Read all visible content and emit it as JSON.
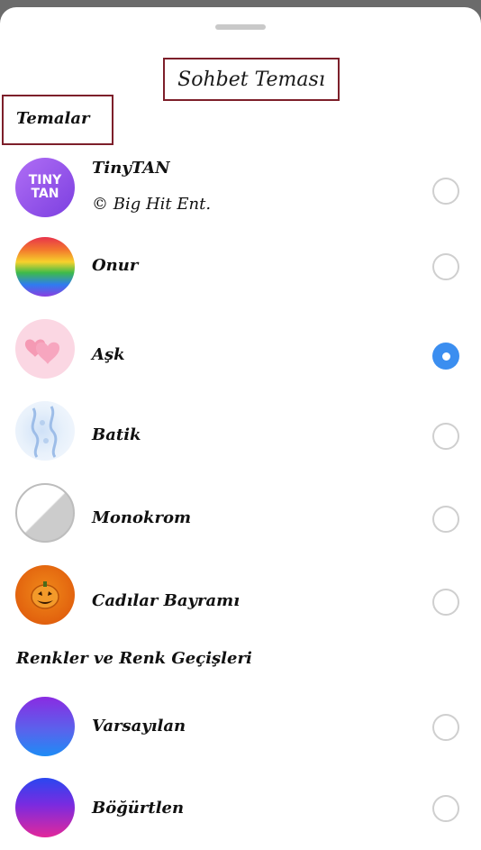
{
  "sheet": {
    "title": "Sohbet Teması"
  },
  "sections": {
    "themes": "Temalar",
    "colors": "Renkler ve Renk Geçişleri"
  },
  "themes": [
    {
      "name": "TinyTAN",
      "subtitle": "© Big Hit Ent.",
      "icon": "tinytan-logo",
      "icon_text": "TINY TAN",
      "selected": false
    },
    {
      "name": "Onur",
      "icon": "rainbow-gradient",
      "selected": false
    },
    {
      "name": "Aşk",
      "icon": "pink-hearts",
      "selected": true
    },
    {
      "name": "Batik",
      "icon": "batik-pattern",
      "selected": false
    },
    {
      "name": "Monokrom",
      "icon": "monochrome-split",
      "selected": false
    },
    {
      "name": "Cadılar Bayramı",
      "icon": "pumpkin",
      "selected": false
    }
  ],
  "colors": [
    {
      "name": "Varsayılan",
      "icon": "purple-blue-gradient",
      "selected": false
    },
    {
      "name": "Böğürtlen",
      "icon": "blue-purple-pink-gradient",
      "selected": false
    }
  ],
  "accent": {
    "radio_selected": "#3b8ef0",
    "annotation_border": "#7d1f2a"
  }
}
